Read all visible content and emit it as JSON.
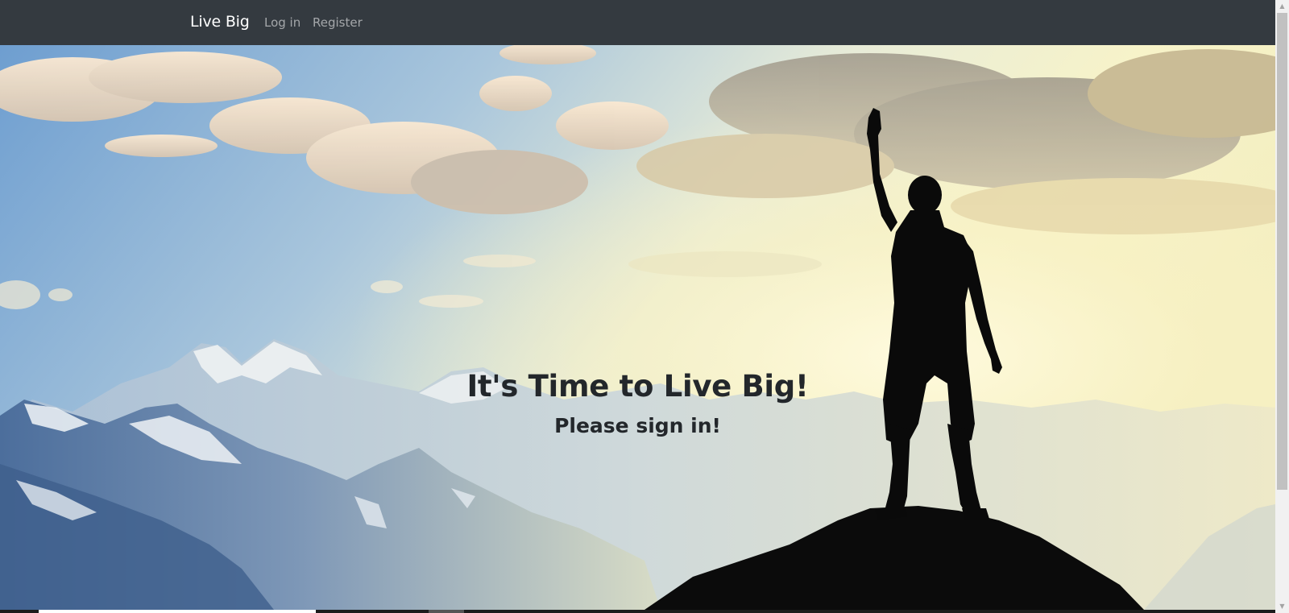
{
  "navbar": {
    "brand": "Live Big",
    "links": [
      {
        "label": "Log in"
      },
      {
        "label": "Register"
      }
    ]
  },
  "hero": {
    "title": "It's Time to Live Big!",
    "subtitle": "Please sign in!"
  },
  "scrollbar": {
    "up_arrow": "▲",
    "down_arrow": "▼"
  },
  "colors": {
    "navbar_bg": "#343a40",
    "text_dark": "#23272b"
  }
}
